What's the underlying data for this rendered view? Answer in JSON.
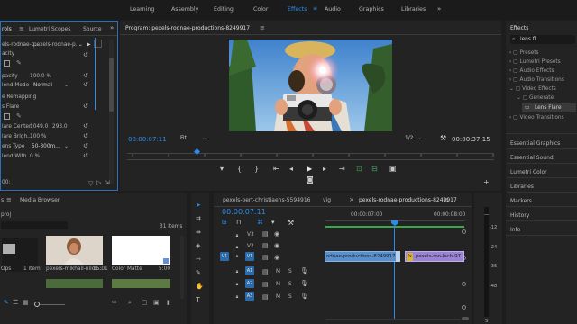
{
  "workspaces": {
    "items": [
      {
        "label": "Learning"
      },
      {
        "label": "Assembly"
      },
      {
        "label": "Editing"
      },
      {
        "label": "Color"
      },
      {
        "label": "Effects"
      },
      {
        "label": "Audio"
      },
      {
        "label": "Graphics"
      },
      {
        "label": "Libraries"
      }
    ],
    "active": "Effects"
  },
  "effect_controls": {
    "tabs": [
      "rols",
      "Lumetri Scopes",
      "Source"
    ],
    "clip_name": "els-rodnae-p...",
    "clip_tab": "pexels-rodnae-p...",
    "rows": [
      {
        "label": "acity"
      },
      {
        "label": "pacity",
        "value": "100.0 %"
      },
      {
        "label": "lend Mode",
        "value": "Normal"
      },
      {
        "label": "e Remapping"
      },
      {
        "label": "s Flare"
      },
      {
        "label": "lare Center",
        "value": "1049.0",
        "value2": "293.0"
      },
      {
        "label": "lare Brigh...",
        "value": "100 %"
      },
      {
        "label": "ens Type",
        "value": "50-300m..."
      },
      {
        "label": "lend With ...",
        "value": "0 %"
      }
    ],
    "bottom_time": "00:"
  },
  "program": {
    "title": "Program: pexels-rodnae-productions-8249917",
    "timecode": "00:00:07:11",
    "fit": "Fit",
    "ratio": "1/2",
    "duration": "00:00:37:15"
  },
  "project": {
    "tabs": [
      "s",
      "Media Browser"
    ],
    "name": "proj",
    "count": "31 items",
    "items": [
      {
        "label": "Ops",
        "sub": "1 item"
      },
      {
        "label": "pexels-mikhail-nilov...",
        "sub": "15:01"
      },
      {
        "label": "Color Matte",
        "sub": "5:00"
      }
    ]
  },
  "timeline": {
    "tabs": [
      "pexels-bert-christiaens-5594916",
      "vig",
      "pexels-rodnae-productions-8249917"
    ],
    "timecode": "00:00:07:11",
    "ruler": [
      "00:00:07:00",
      "00:00:08:00"
    ],
    "video_tracks": [
      "V3",
      "V2",
      "V1"
    ],
    "audio_tracks": [
      "A1",
      "A2",
      "A3"
    ],
    "source_patch": "V1",
    "clip1": "odnae-productions-8249917.mp4",
    "clip2": "pexels-ron-lach-97",
    "fx": "fx",
    "meter_labels": [
      "-12",
      "-24",
      "-36",
      "-48"
    ]
  },
  "effects_panel": {
    "title": "Effects",
    "search": "lens fl",
    "tree": [
      "Presets",
      "Lumetri Presets",
      "Audio Effects",
      "Audio Transitions",
      "Video Effects",
      "Generate",
      "Lens Flare",
      "Video Transitions"
    ],
    "sections": [
      "Essential Graphics",
      "Essential Sound",
      "Lumetri Color",
      "Libraries",
      "Markers",
      "History",
      "Info"
    ]
  },
  "colors": {
    "accent": "#2d8ceb",
    "clip_blue": "#5b8fc9",
    "clip_purple": "#9a84d2"
  }
}
